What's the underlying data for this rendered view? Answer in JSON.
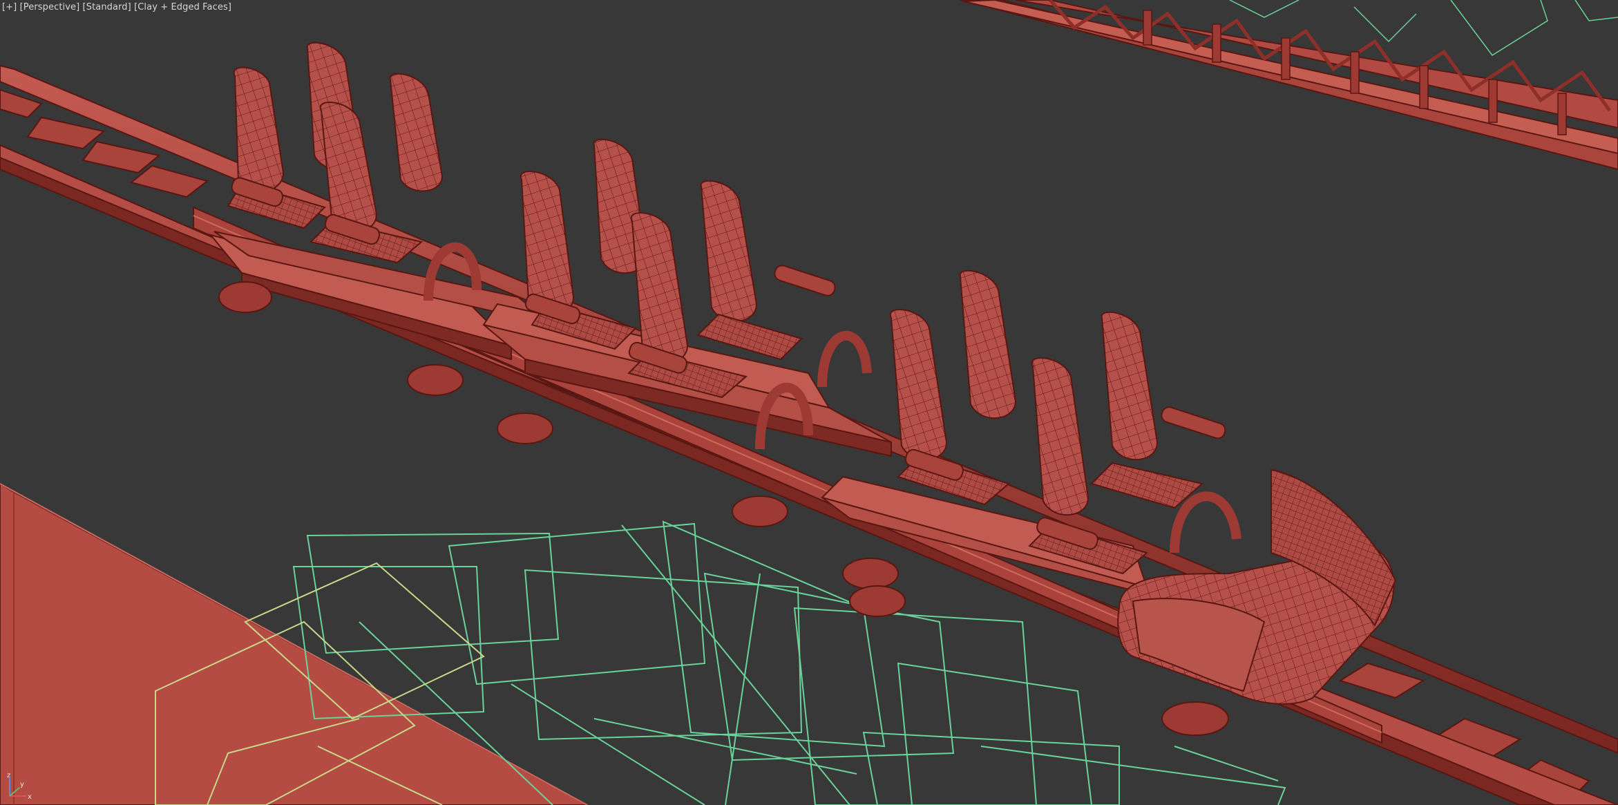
{
  "viewport": {
    "menu_plus": "[+]",
    "view_name": "[Perspective]",
    "shading_mode": "[Standard]",
    "display_style": "[Clay + Edged Faces]"
  },
  "colors": {
    "background": "#383838",
    "clay": "#b04a42",
    "clay_dark": "#7d2a24",
    "wire": "#5b1612",
    "helper_green": "#6ad39a",
    "helper_yellow": "#c8d88a"
  },
  "gizmo": {
    "axes": [
      "x",
      "y",
      "z"
    ]
  }
}
